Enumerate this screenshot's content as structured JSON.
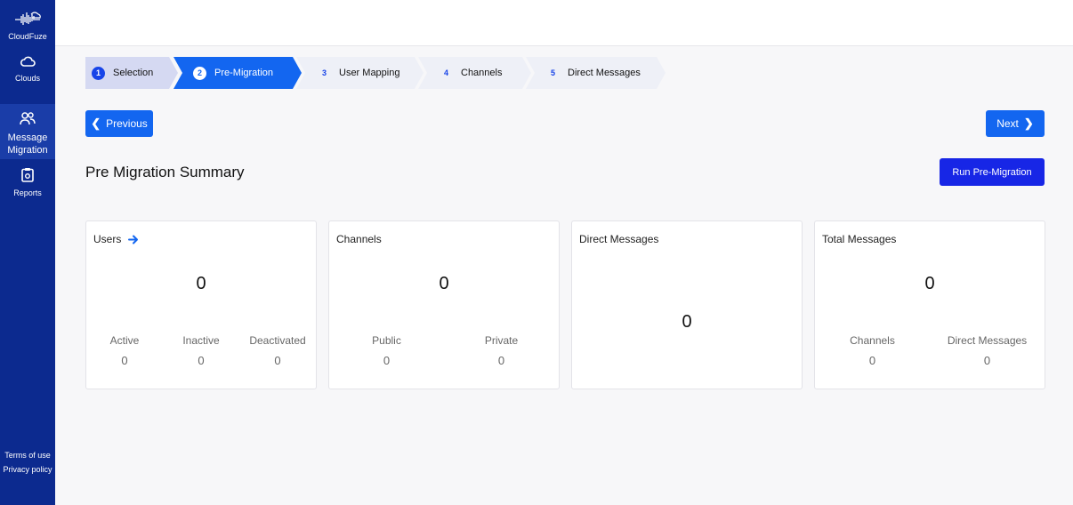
{
  "sidebar": {
    "brand": "CloudFuze",
    "items": [
      {
        "label": "Clouds",
        "icon": "cloud-icon"
      },
      {
        "label": "Message Migration",
        "line1": "Message",
        "line2": "Migration",
        "icon": "users-icon"
      },
      {
        "label": "Reports",
        "icon": "clipboard-icon"
      }
    ],
    "terms": "Terms of use",
    "privacy": "Privacy policy"
  },
  "stepper": [
    {
      "num": "1",
      "label": "Selection",
      "state": "done"
    },
    {
      "num": "2",
      "label": "Pre-Migration",
      "state": "current"
    },
    {
      "num": "3",
      "label": "User Mapping",
      "state": "todo"
    },
    {
      "num": "4",
      "label": "Channels",
      "state": "todo"
    },
    {
      "num": "5",
      "label": "Direct Messages",
      "state": "todo"
    }
  ],
  "buttons": {
    "previous": "Previous",
    "next": "Next",
    "run": "Run Pre-Migration"
  },
  "page_title": "Pre Migration Summary",
  "cards": {
    "users": {
      "title": "Users",
      "total": "0",
      "stats": [
        {
          "label": "Active",
          "value": "0"
        },
        {
          "label": "Inactive",
          "value": "0"
        },
        {
          "label": "Deactivated",
          "value": "0"
        }
      ]
    },
    "channels": {
      "title": "Channels",
      "total": "0",
      "stats": [
        {
          "label": "Public",
          "value": "0"
        },
        {
          "label": "Private",
          "value": "0"
        }
      ]
    },
    "direct_messages": {
      "title": "Direct Messages",
      "total": "0"
    },
    "total_messages": {
      "title": "Total Messages",
      "total": "0",
      "stats": [
        {
          "label": "Channels",
          "value": "0"
        },
        {
          "label": "Direct Messages",
          "value": "0"
        }
      ]
    }
  },
  "colors": {
    "sidebar": "#0c2a8f",
    "accent": "#1366f0",
    "run_button": "#1726e6"
  }
}
